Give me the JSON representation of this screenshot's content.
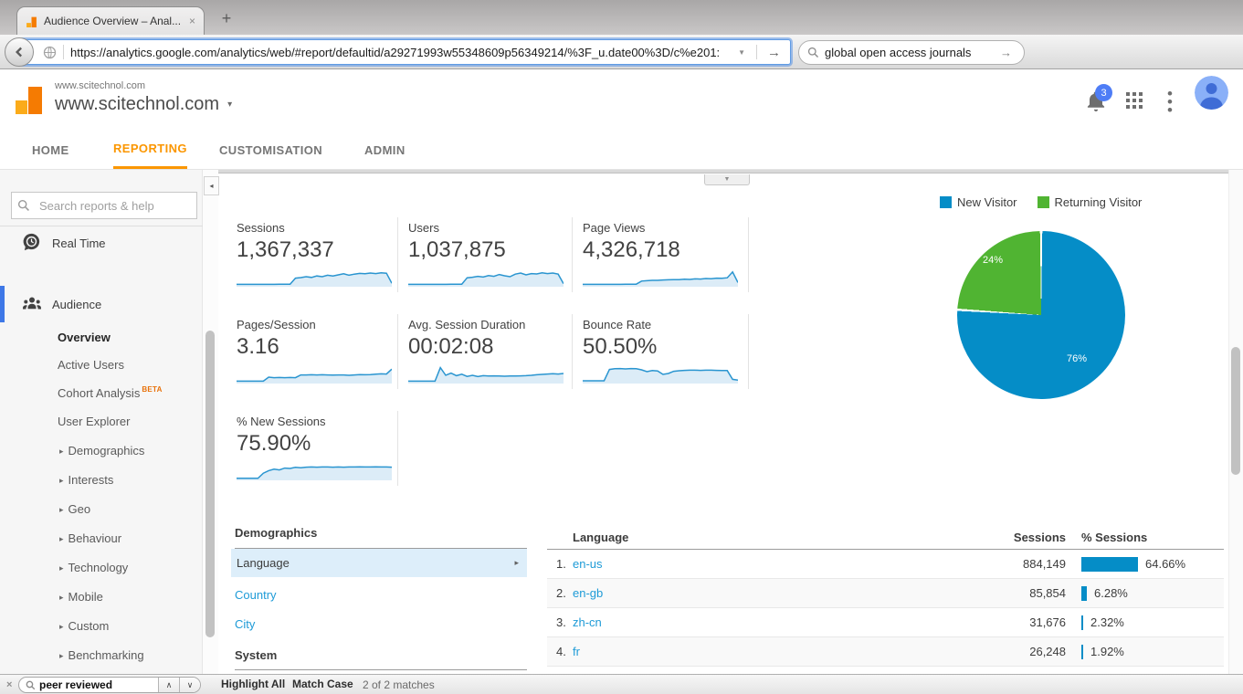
{
  "browser": {
    "tab": {
      "title": "Audience Overview – Anal..."
    },
    "toolbar": {
      "url": "https://analytics.google.com/analytics/web/#report/defaultid/a29271993w55348609p56349214/%3F_u.date00%3D/c%e201:",
      "search_value": "global open access journals"
    },
    "findbar": {
      "value": "peer reviewed",
      "highlight_all": "Highlight All",
      "match_case": "Match Case",
      "matches": "2 of 2 matches"
    }
  },
  "ga": {
    "header": {
      "account": "www.scitechnol.com",
      "property": "www.scitechnol.com",
      "notification_count": "3"
    },
    "nav": [
      {
        "label": "HOME"
      },
      {
        "label": "REPORTING"
      },
      {
        "label": "CUSTOMISATION"
      },
      {
        "label": "ADMIN"
      }
    ],
    "sidebar": {
      "search_placeholder": "Search reports & help",
      "realtime": "Real Time",
      "audience": "Audience",
      "children": [
        {
          "label": "Overview"
        },
        {
          "label": "Active Users"
        },
        {
          "label": "Cohort Analysis",
          "badge": "BETA"
        },
        {
          "label": "User Explorer"
        },
        {
          "label": "Demographics"
        },
        {
          "label": "Interests"
        },
        {
          "label": "Geo"
        },
        {
          "label": "Behaviour"
        },
        {
          "label": "Technology"
        },
        {
          "label": "Mobile"
        },
        {
          "label": "Custom"
        },
        {
          "label": "Benchmarking"
        }
      ]
    }
  },
  "metrics": [
    {
      "label": "Sessions",
      "value": "1,367,337",
      "spark": [
        8,
        8,
        8,
        8,
        8,
        8,
        8,
        8,
        9,
        9,
        9,
        42,
        45,
        50,
        46,
        54,
        50,
        58,
        54,
        60,
        66,
        58,
        64,
        68,
        66,
        70,
        67,
        71,
        69,
        14
      ]
    },
    {
      "label": "Users",
      "value": "1,037,875",
      "spark": [
        8,
        8,
        8,
        8,
        8,
        8,
        8,
        8,
        9,
        9,
        9,
        44,
        47,
        52,
        48,
        56,
        52,
        62,
        55,
        50,
        64,
        70,
        60,
        67,
        65,
        71,
        67,
        70,
        64,
        12
      ]
    },
    {
      "label": "Page Views",
      "value": "4,326,718",
      "spark": [
        8,
        8,
        8,
        8,
        8,
        8,
        8,
        8,
        9,
        9,
        9,
        26,
        28,
        30,
        30,
        32,
        33,
        34,
        34,
        36,
        35,
        38,
        37,
        40,
        39,
        42,
        41,
        44,
        76,
        18
      ]
    },
    {
      "label": "Pages/Session",
      "value": "3.16",
      "spark": [
        8,
        8,
        8,
        8,
        8,
        8,
        30,
        27,
        28,
        27,
        28,
        27,
        42,
        42,
        43,
        42,
        43,
        42,
        41,
        42,
        42,
        40,
        42,
        44,
        43,
        44,
        46,
        48,
        47,
        74
      ]
    },
    {
      "label": "Avg. Session Duration",
      "value": "00:02:08",
      "spark": [
        8,
        8,
        8,
        8,
        8,
        8,
        82,
        40,
        52,
        38,
        46,
        34,
        40,
        33,
        38,
        36,
        37,
        36,
        35,
        36,
        36,
        37,
        38,
        40,
        43,
        45,
        47,
        49,
        47,
        50
      ]
    },
    {
      "label": "Bounce Rate",
      "value": "50.50%",
      "spark": [
        10,
        10,
        10,
        10,
        10,
        72,
        76,
        77,
        75,
        77,
        76,
        70,
        60,
        66,
        64,
        45,
        50,
        62,
        65,
        67,
        68,
        68,
        67,
        68,
        68,
        67,
        66,
        66,
        18,
        14
      ]
    },
    {
      "label": "% New Sessions",
      "value": "75.90%",
      "spark": [
        6,
        6,
        6,
        6,
        6,
        34,
        48,
        56,
        52,
        62,
        60,
        66,
        64,
        67,
        68,
        67,
        68,
        68,
        67,
        68,
        67,
        68,
        68,
        69,
        68,
        68,
        69,
        68,
        68,
        67
      ]
    }
  ],
  "chart_data": {
    "type": "pie",
    "labels": [
      "New Visitor",
      "Returning Visitor"
    ],
    "values": [
      76,
      24
    ],
    "value_labels": [
      "76%",
      "24%"
    ],
    "colors": [
      "#058dc7",
      "#50b432"
    ],
    "legend_position": "top"
  },
  "demographics": {
    "title": "Demographics",
    "selected": "Language",
    "links": [
      "Country",
      "City"
    ],
    "system_title": "System"
  },
  "language_table": {
    "col_language": "Language",
    "col_sessions": "Sessions",
    "col_percent": "% Sessions",
    "rows": [
      {
        "rank": "1.",
        "language": "en-us",
        "sessions": "884,149",
        "percent": "64.66%",
        "bar": 64.66
      },
      {
        "rank": "2.",
        "language": "en-gb",
        "sessions": "85,854",
        "percent": "6.28%",
        "bar": 6.28
      },
      {
        "rank": "3.",
        "language": "zh-cn",
        "sessions": "31,676",
        "percent": "2.32%",
        "bar": 2.32
      },
      {
        "rank": "4.",
        "language": "fr",
        "sessions": "26,248",
        "percent": "1.92%",
        "bar": 1.92
      }
    ]
  },
  "icons": {
    "close": "×",
    "plus": "+",
    "caret_down": "▾",
    "dropdown": "▼",
    "triangle_right": "▸",
    "arrow_right": "→",
    "chevron_up": "∧",
    "chevron_down": "∨",
    "collapse_left": "◂",
    "hamburger": "≡"
  }
}
